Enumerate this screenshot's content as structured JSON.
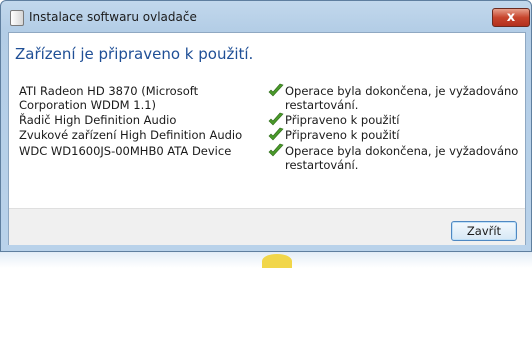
{
  "window": {
    "title": "Instalace softwaru ovladače",
    "close_glyph": "x",
    "heading": "Zařízení je připraveno k použití."
  },
  "devices": [
    {
      "name": "ATI Radeon HD 3870 (Microsoft Corporation WDDM 1.1)",
      "status": "Operace byla dokončena, je vyžadováno restartování.",
      "icon": "checkmark-icon"
    },
    {
      "name": "Řadič High Definition Audio",
      "status": "Připraveno k použití",
      "icon": "checkmark-icon"
    },
    {
      "name": "Zvukové zařízení High Definition Audio",
      "status": "Připraveno k použití",
      "icon": "checkmark-icon"
    },
    {
      "name": "WDC WD1600JS-00MHB0 ATA Device",
      "status": "Operace byla dokončena, je vyžadováno restartování.",
      "icon": "checkmark-icon"
    }
  ],
  "footer": {
    "close_label": "Zavřít"
  },
  "colors": {
    "heading": "#1f4f96",
    "check": "#4a9a2a",
    "close_button": "#c7452d"
  }
}
